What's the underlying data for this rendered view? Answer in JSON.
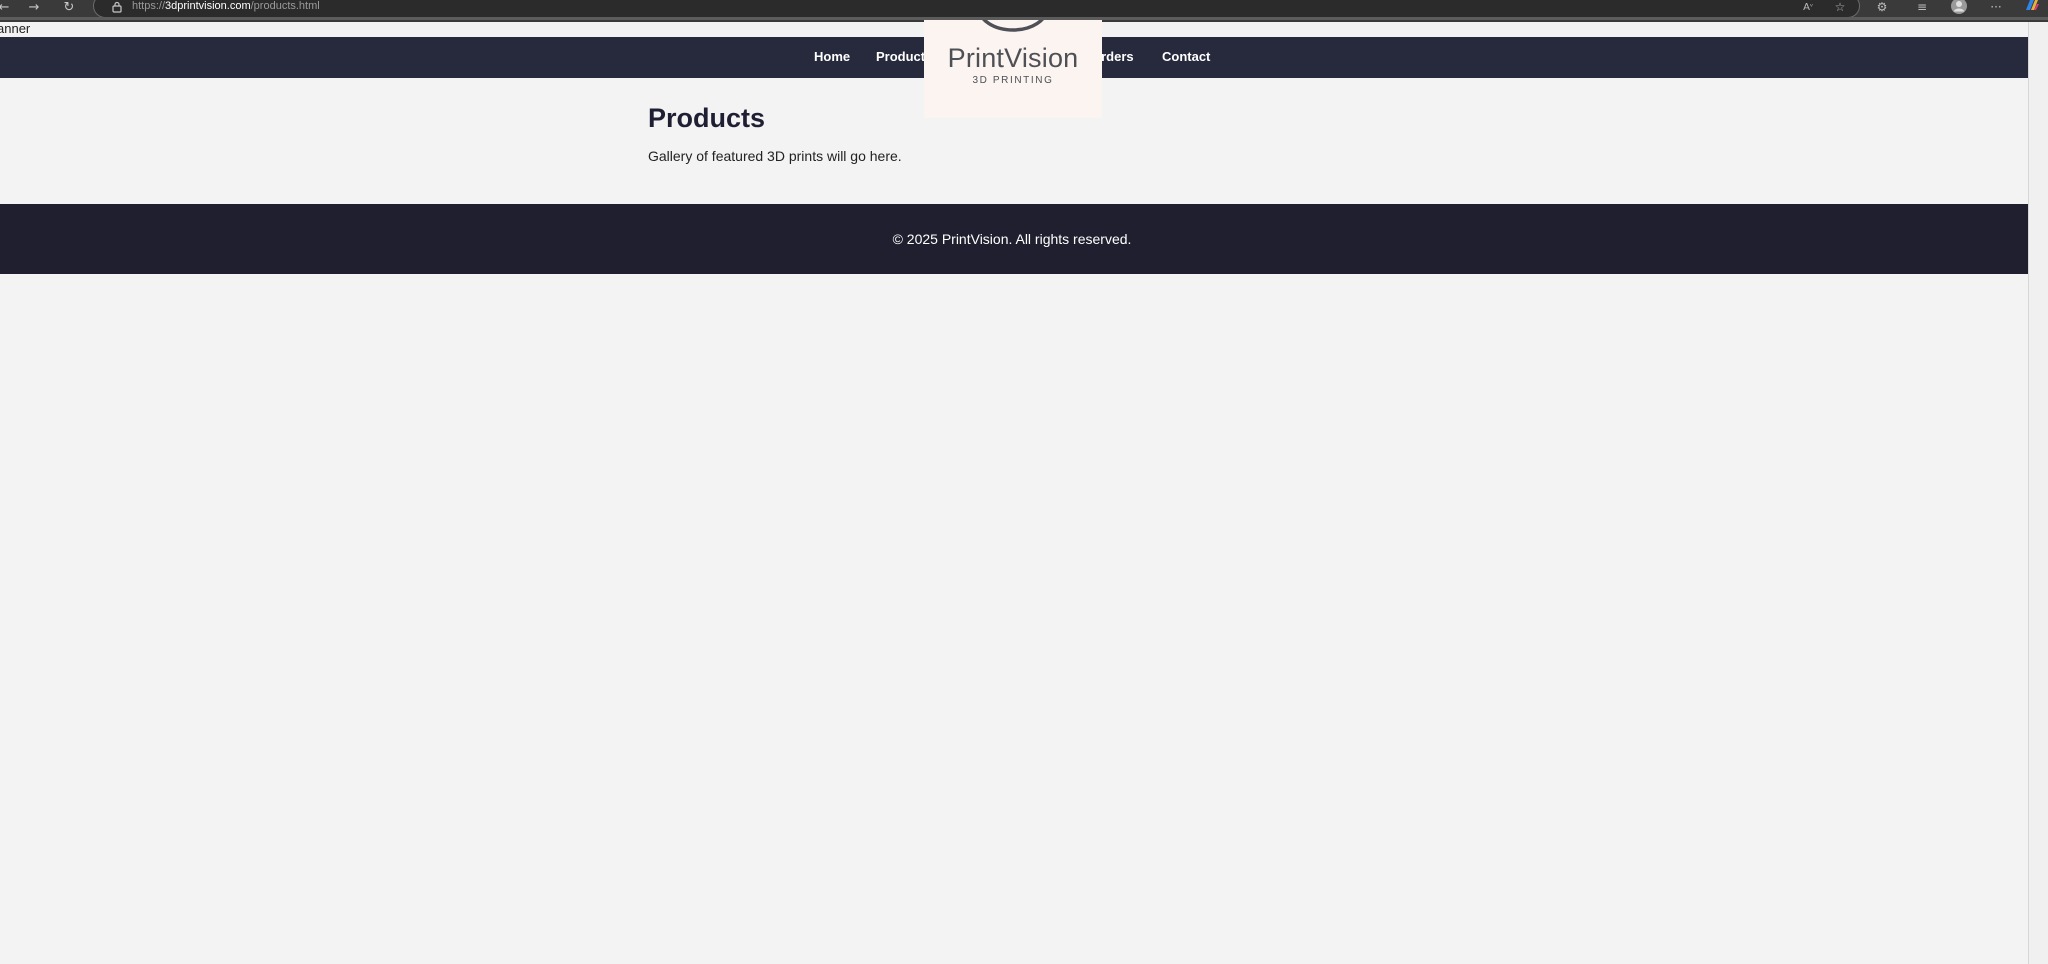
{
  "browser": {
    "url_scheme": "https://",
    "url_host": "3dprintvision.com",
    "url_path": "/products.html",
    "icons": {
      "back": "back-arrow-icon",
      "forward": "forward-arrow-icon",
      "reload": "reload-icon",
      "lock": "lock-icon",
      "read_aloud": "read-aloud-icon",
      "favorite": "star-icon",
      "extensions": "extensions-icon",
      "favorites": "favorites-icon",
      "profile": "profile-icon",
      "menu": "more-menu-icon",
      "copilot": "copilot-icon"
    }
  },
  "banner": {
    "label": "anner"
  },
  "nav": {
    "items": [
      {
        "label": "Home"
      },
      {
        "label": "Products"
      },
      {
        "label": "Orders"
      },
      {
        "label": "Contact"
      }
    ]
  },
  "logo": {
    "name": "PrintVision",
    "tagline": "3D PRINTING"
  },
  "main": {
    "title": "Products",
    "description": "Gallery of featured 3D prints will go here."
  },
  "footer": {
    "text": "© 2025 PrintVision. All rights reserved."
  },
  "colors": {
    "nav_bg": "#272a3d",
    "footer_bg": "#1f1f2f",
    "page_bg": "#f3f3f3",
    "logo_bg": "#fbf4f0"
  }
}
